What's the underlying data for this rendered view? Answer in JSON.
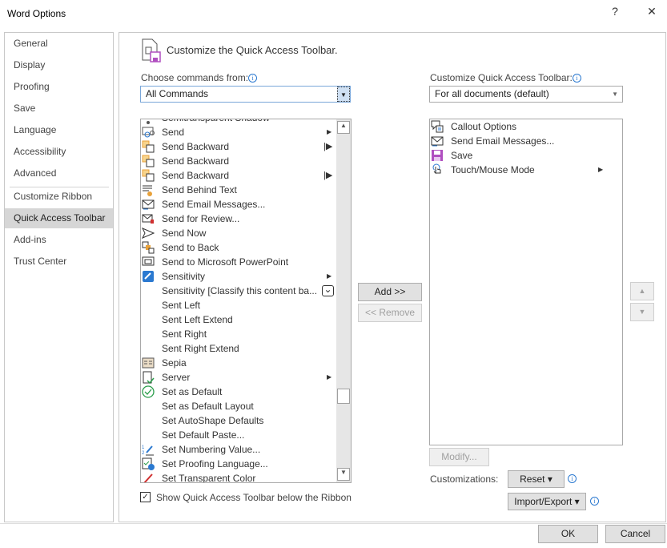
{
  "window": {
    "title": "Word Options",
    "help": "?",
    "close": "✕"
  },
  "sidebar": {
    "items": [
      "General",
      "Display",
      "Proofing",
      "Save",
      "Language",
      "Accessibility",
      "Advanced",
      "Customize Ribbon",
      "Quick Access Toolbar",
      "Add-ins",
      "Trust Center"
    ],
    "selected": "Quick Access Toolbar"
  },
  "main": {
    "heading": "Customize the Quick Access Toolbar.",
    "choose_label": "Choose commands from:",
    "choose_value": "All Commands",
    "customize_label": "Customize Quick Access Toolbar:",
    "customize_value": "For all documents (default)",
    "commands": [
      {
        "label": "Semitransparent Shadow",
        "icon": "shadow-icon"
      },
      {
        "label": "Send",
        "icon": "send-icon",
        "sub": "arrow"
      },
      {
        "label": "Send Backward",
        "icon": "send-backward-icon",
        "sub": "split"
      },
      {
        "label": "Send Backward",
        "icon": "send-backward-icon"
      },
      {
        "label": "Send Backward",
        "icon": "send-backward-icon",
        "sub": "split"
      },
      {
        "label": "Send Behind Text",
        "icon": "send-behind-text-icon"
      },
      {
        "label": "Send Email Messages...",
        "icon": "email-icon"
      },
      {
        "label": "Send for Review...",
        "icon": "review-icon"
      },
      {
        "label": "Send Now",
        "icon": "send-now-icon"
      },
      {
        "label": "Send to Back",
        "icon": "send-to-back-icon"
      },
      {
        "label": "Send to Microsoft PowerPoint",
        "icon": "powerpoint-icon"
      },
      {
        "label": "Sensitivity",
        "icon": "sensitivity-icon",
        "sub": "arrow"
      },
      {
        "label": "Sensitivity [Classify this content ba...",
        "icon": "",
        "sub": "combo"
      },
      {
        "label": "Sent Left",
        "icon": ""
      },
      {
        "label": "Sent Left Extend",
        "icon": ""
      },
      {
        "label": "Sent Right",
        "icon": ""
      },
      {
        "label": "Sent Right Extend",
        "icon": ""
      },
      {
        "label": "Sepia",
        "icon": "sepia-icon"
      },
      {
        "label": "Server",
        "icon": "server-icon",
        "sub": "arrow"
      },
      {
        "label": "Set as Default",
        "icon": "check-circle-icon"
      },
      {
        "label": "Set as Default Layout",
        "icon": ""
      },
      {
        "label": "Set AutoShape Defaults",
        "icon": ""
      },
      {
        "label": "Set Default Paste...",
        "icon": ""
      },
      {
        "label": "Set Numbering Value...",
        "icon": "numbering-icon"
      },
      {
        "label": "Set Proofing Language...",
        "icon": "proofing-language-icon"
      },
      {
        "label": "Set Transparent Color",
        "icon": "transparent-color-icon"
      }
    ],
    "toolbar_items": [
      {
        "label": "Callout Options",
        "icon": "callout-icon"
      },
      {
        "label": "Send Email Messages...",
        "icon": "email-icon"
      },
      {
        "label": "Save",
        "icon": "save-icon"
      },
      {
        "label": "Touch/Mouse Mode",
        "icon": "touch-icon",
        "sub": "arrow"
      }
    ],
    "add": "Add >>",
    "remove": "<< Remove",
    "modify": "Modify...",
    "customizations_label": "Customizations:",
    "reset": "Reset ▾",
    "import_export": "Import/Export ▾",
    "show_below": "Show Quick Access Toolbar below the Ribbon",
    "show_below_checked": true
  },
  "footer": {
    "ok": "OK",
    "cancel": "Cancel"
  },
  "colors": {
    "accent": "#2b79d0",
    "save": "#b04fc0",
    "orange": "#e8a13a"
  }
}
